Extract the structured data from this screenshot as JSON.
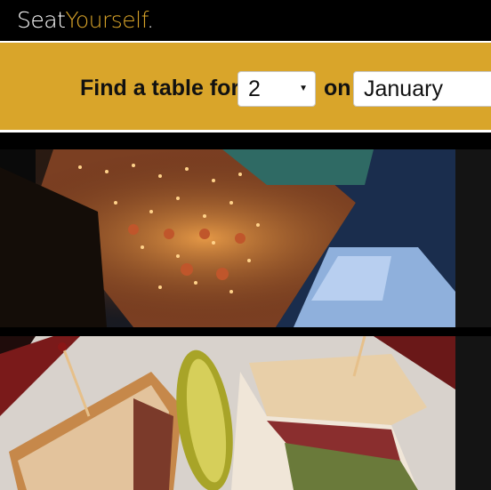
{
  "header": {
    "logo_part1": "Seat",
    "logo_part2": "Yourself",
    "logo_dot": "."
  },
  "finder": {
    "label": "Find a table for",
    "party_size": "2",
    "on_label": "on",
    "month": "January"
  },
  "colors": {
    "accent": "#d9a52a",
    "background": "#000000"
  }
}
